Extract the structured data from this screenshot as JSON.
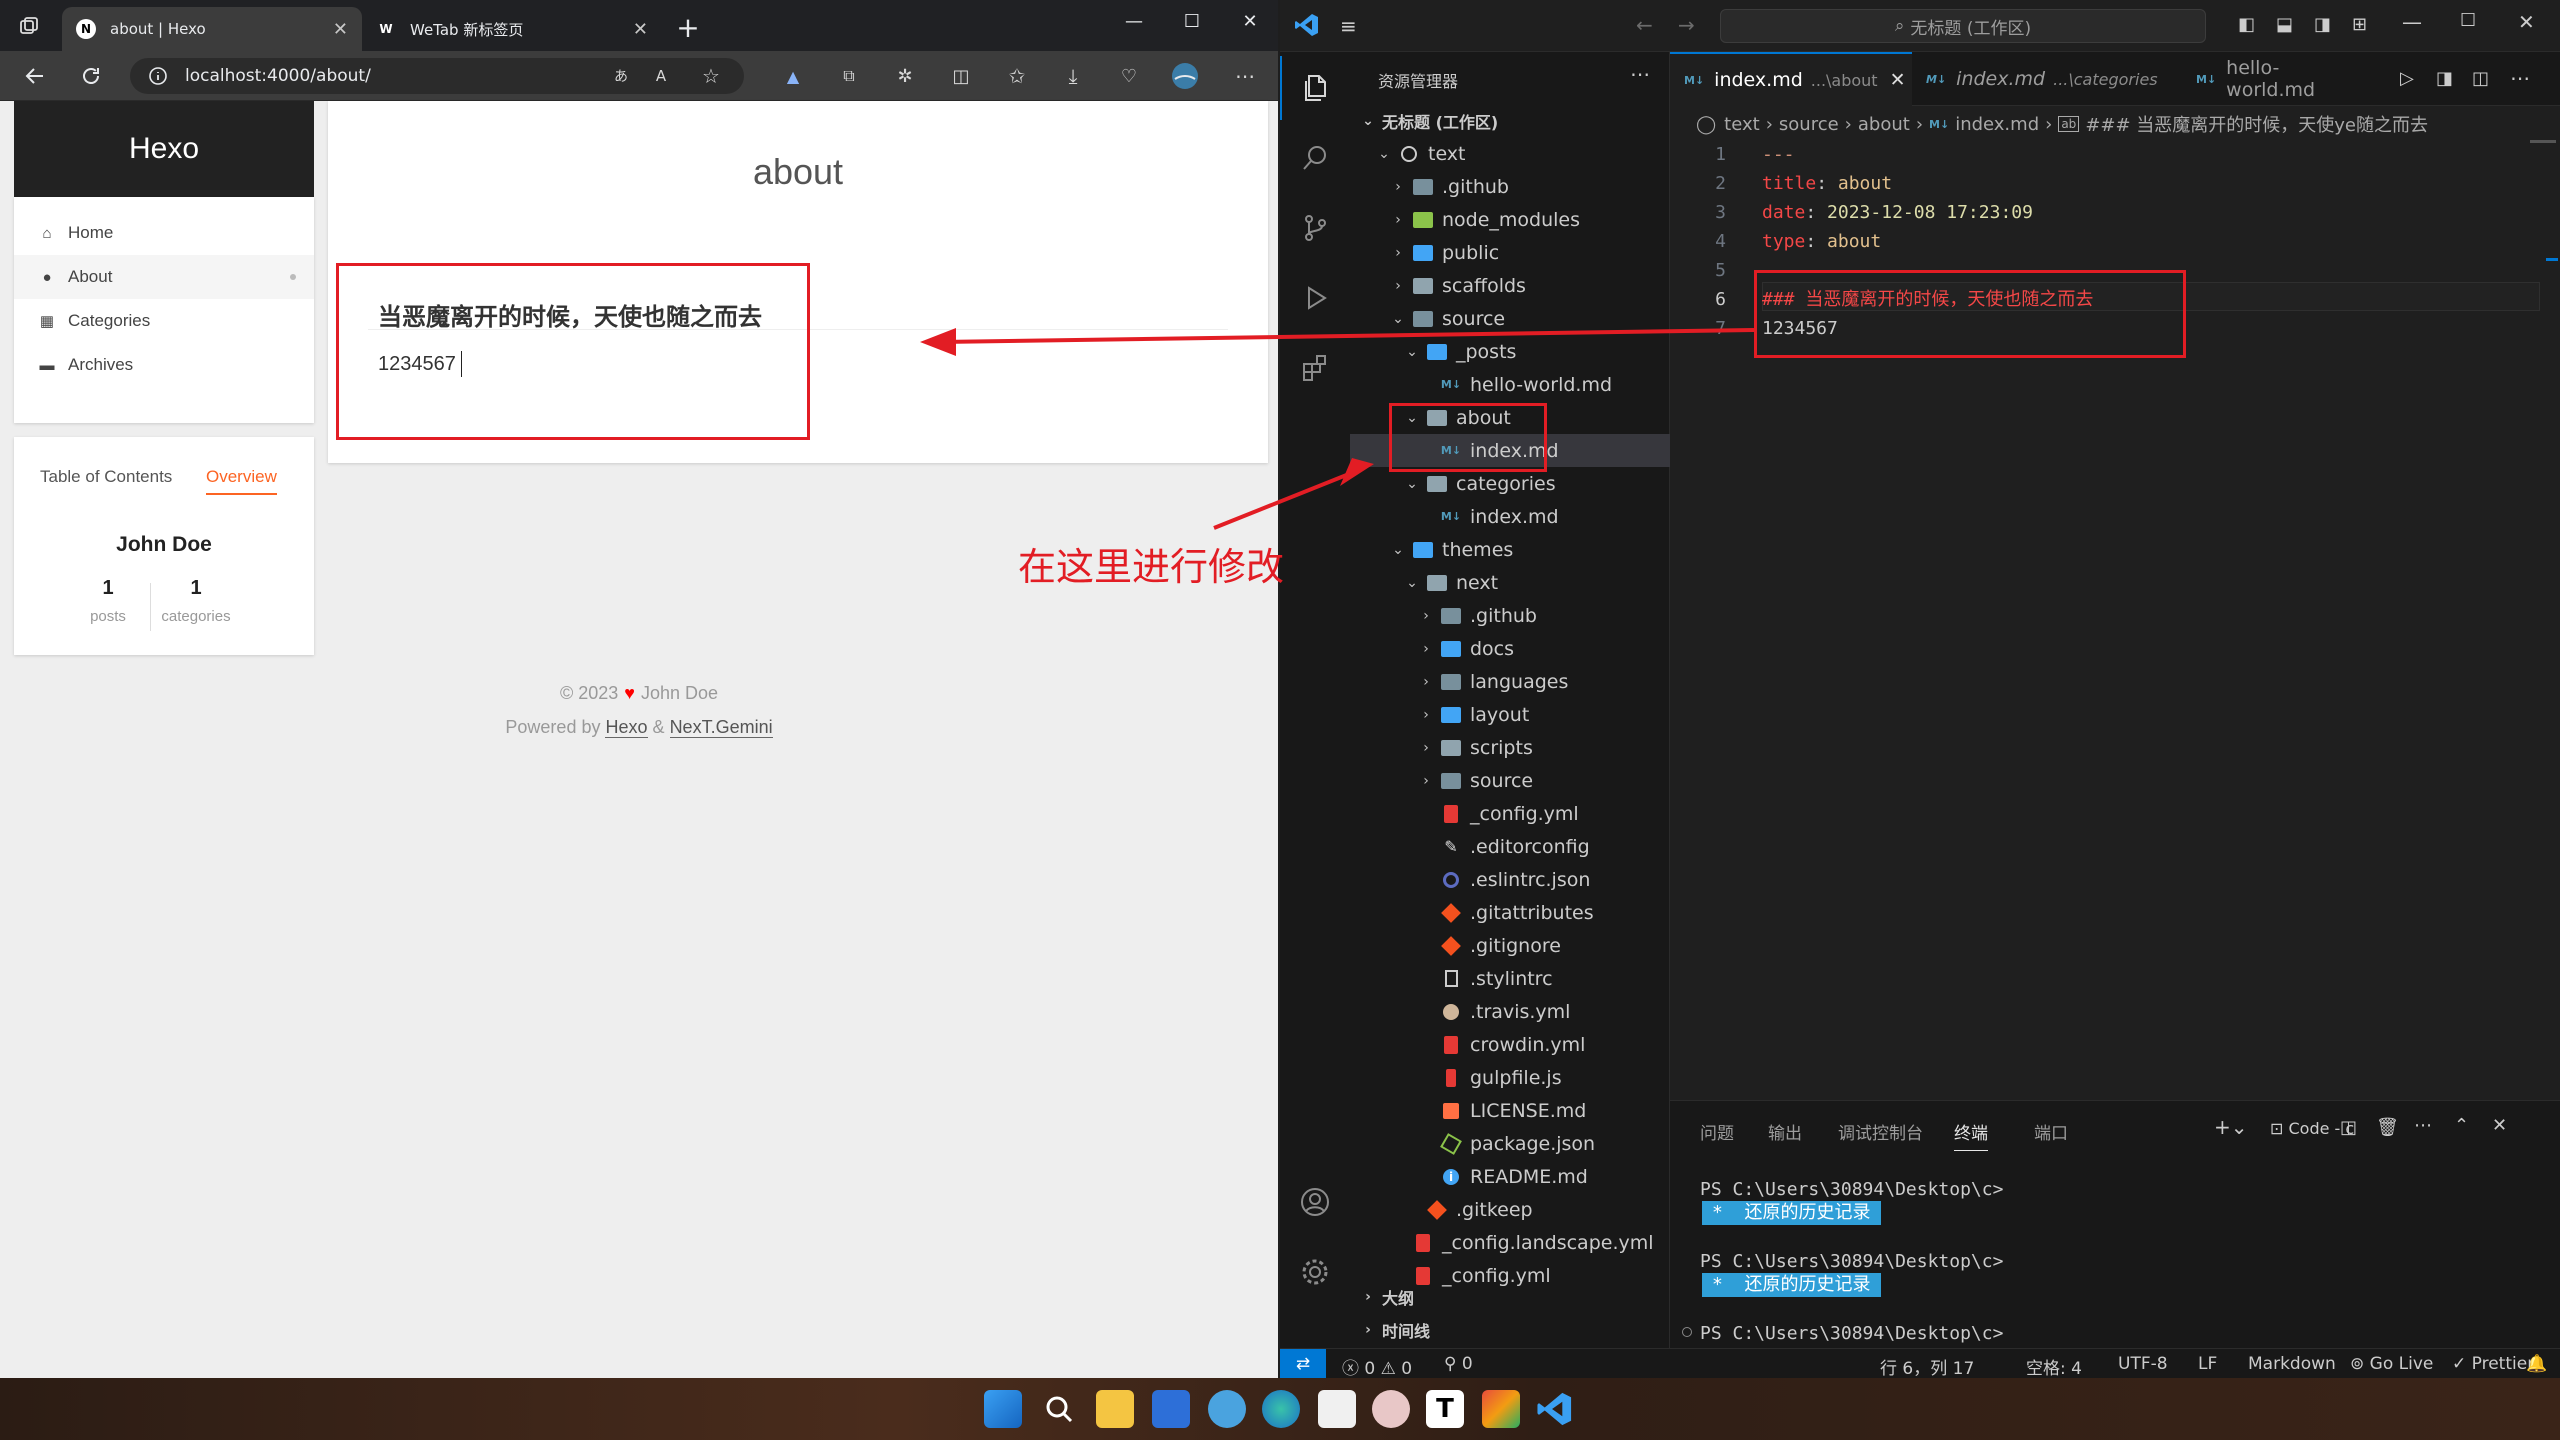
{
  "browser": {
    "tabs": [
      {
        "title": "about | Hexo",
        "favicon": "N"
      },
      {
        "title": "WeTab 新标签页",
        "favicon": "W"
      }
    ],
    "url": "localhost:4000/about/"
  },
  "site": {
    "brand": "Hexo",
    "menu": [
      {
        "icon": "home-icon",
        "label": "Home"
      },
      {
        "icon": "user-icon",
        "label": "About"
      },
      {
        "icon": "grid-icon",
        "label": "Categories"
      },
      {
        "icon": "archive-icon",
        "label": "Archives"
      }
    ],
    "toc_tab": "Table of Contents",
    "overview_tab": "Overview",
    "author": "John Doe",
    "stats": [
      {
        "count": "1",
        "label": "posts"
      },
      {
        "count": "1",
        "label": "categories"
      }
    ],
    "page_title": "about",
    "heading": "当恶魔离开的时候，天使也随之而去",
    "paragraph": "1234567",
    "footer_copyright": "© 2023",
    "footer_author": "John Doe",
    "footer_powered": "Powered by",
    "footer_hexo": "Hexo",
    "footer_amp": "&",
    "footer_theme": "NexT.Gemini"
  },
  "annotation": "在这里进行修改",
  "vscode": {
    "search_placeholder": "无标题 (工作区)",
    "explorer_title": "资源管理器",
    "workspace": "无标题 (工作区)",
    "tree": [
      {
        "label": "text",
        "depth": 0,
        "type": "root"
      },
      {
        "label": ".github",
        "depth": 1,
        "type": "folder"
      },
      {
        "label": "node_modules",
        "depth": 1,
        "type": "folder"
      },
      {
        "label": "public",
        "depth": 1,
        "type": "folder"
      },
      {
        "label": "scaffolds",
        "depth": 1,
        "type": "folder"
      },
      {
        "label": "source",
        "depth": 1,
        "type": "folder-open"
      },
      {
        "label": "_posts",
        "depth": 2,
        "type": "folder-open"
      },
      {
        "label": "hello-world.md",
        "depth": 3,
        "type": "md"
      },
      {
        "label": "about",
        "depth": 2,
        "type": "folder-open"
      },
      {
        "label": "index.md",
        "depth": 3,
        "type": "md",
        "selected": true
      },
      {
        "label": "categories",
        "depth": 2,
        "type": "folder-open"
      },
      {
        "label": "index.md",
        "depth": 3,
        "type": "md"
      },
      {
        "label": "themes",
        "depth": 1,
        "type": "folder-open"
      },
      {
        "label": "next",
        "depth": 2,
        "type": "folder-open"
      },
      {
        "label": ".github",
        "depth": 3,
        "type": "folder"
      },
      {
        "label": "docs",
        "depth": 3,
        "type": "folder"
      },
      {
        "label": "languages",
        "depth": 3,
        "type": "folder"
      },
      {
        "label": "layout",
        "depth": 3,
        "type": "folder"
      },
      {
        "label": "scripts",
        "depth": 3,
        "type": "folder"
      },
      {
        "label": "source",
        "depth": 3,
        "type": "folder"
      },
      {
        "label": "_config.yml",
        "depth": 3,
        "type": "yml"
      },
      {
        "label": ".editorconfig",
        "depth": 3,
        "type": "cfg"
      },
      {
        "label": ".eslintrc.json",
        "depth": 3,
        "type": "eslint"
      },
      {
        "label": ".gitattributes",
        "depth": 3,
        "type": "git"
      },
      {
        "label": ".gitignore",
        "depth": 3,
        "type": "git"
      },
      {
        "label": ".stylintrc",
        "depth": 3,
        "type": "file"
      },
      {
        "label": ".travis.yml",
        "depth": 3,
        "type": "travis"
      },
      {
        "label": "crowdin.yml",
        "depth": 3,
        "type": "yml"
      },
      {
        "label": "gulpfile.js",
        "depth": 3,
        "type": "gulp"
      },
      {
        "label": "LICENSE.md",
        "depth": 3,
        "type": "license"
      },
      {
        "label": "package.json",
        "depth": 3,
        "type": "node"
      },
      {
        "label": "README.md",
        "depth": 3,
        "type": "info"
      },
      {
        "label": ".gitkeep",
        "depth": 2,
        "type": "git"
      },
      {
        "label": "_config.landscape.yml",
        "depth": 1,
        "type": "yml"
      },
      {
        "label": "_config.yml",
        "depth": 1,
        "type": "yml"
      }
    ],
    "outline": "大纲",
    "timeline": "时间线",
    "tabs": [
      {
        "name": "index.md",
        "sub": "...\\about",
        "active": true
      },
      {
        "name": "index.md",
        "sub": "...\\categories",
        "active": false
      },
      {
        "name": "hello-world.md",
        "sub": "",
        "active": false
      }
    ],
    "breadcrumbs": [
      "text",
      "source",
      "about",
      "index.md",
      "### 当恶魔离开的时候，天使ye随之而去"
    ],
    "code": [
      {
        "n": "1",
        "t": "---"
      },
      {
        "n": "2",
        "k": "title",
        "v": "about"
      },
      {
        "n": "3",
        "k": "date",
        "v": "2023-12-08 17:23:09"
      },
      {
        "n": "4",
        "k": "type",
        "v": "about"
      },
      {
        "n": "5",
        "t": "---"
      },
      {
        "n": "6",
        "h": "### 当恶魔离开的时候，天使也随之而去"
      },
      {
        "n": "7",
        "t": "1234567"
      }
    ],
    "panel_tabs": [
      "问题",
      "输出",
      "调试控制台",
      "终端",
      "端口"
    ],
    "panel_active": 3,
    "terminal_label": "Code - c",
    "terminal": [
      {
        "prompt": "PS C:\\Users\\30894\\Desktop\\c>",
        "restore": "*  还原的历史记录"
      },
      {
        "prompt": "PS C:\\Users\\30894\\Desktop\\c>",
        "restore": "*  还原的历史记录"
      },
      {
        "prompt": "PS C:\\Users\\30894\\Desktop\\c>",
        "restore": ""
      }
    ],
    "status": {
      "errors": "0",
      "warnings": "0",
      "ports": "0",
      "position": "行 6，列 17",
      "spaces": "空格: 4",
      "encoding": "UTF-8",
      "eol": "LF",
      "language": "Markdown",
      "golive": "Go Live",
      "prettier": "Prettier"
    }
  },
  "colors": {
    "accent_red": "#e21d24",
    "vscode_blue": "#0078d4",
    "hexo_orange": "#fc6423"
  }
}
